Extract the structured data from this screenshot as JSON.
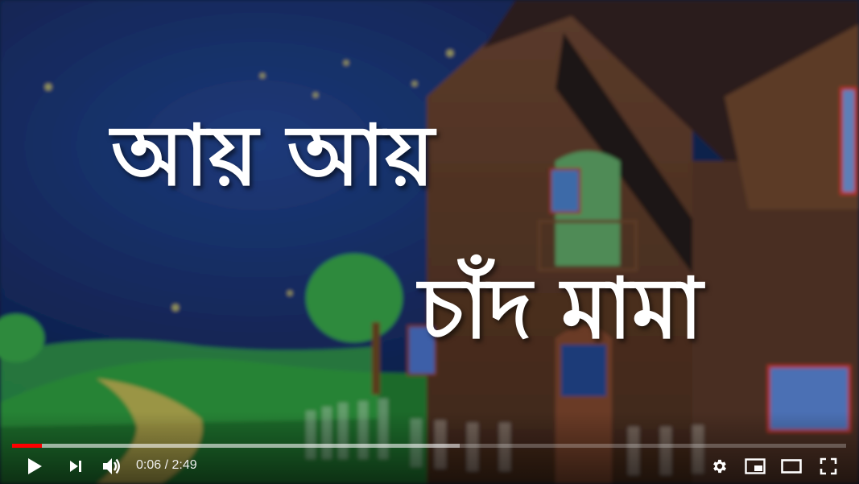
{
  "video": {
    "title_line_1": "আয় আয়",
    "title_line_2": "চাঁদ মামা"
  },
  "player": {
    "current_time": "0:06",
    "separator": " / ",
    "duration": "2:49",
    "progress_played_fraction": 0.036,
    "progress_buffered_fraction": 0.537,
    "accent_color": "#ff0000"
  },
  "controls": {
    "play_icon": "play-icon",
    "next_icon": "next-icon",
    "volume_icon": "volume-icon",
    "settings_icon": "gear-icon",
    "miniplayer_icon": "miniplayer-icon",
    "theater_icon": "theater-mode-icon",
    "fullscreen_icon": "fullscreen-icon"
  }
}
